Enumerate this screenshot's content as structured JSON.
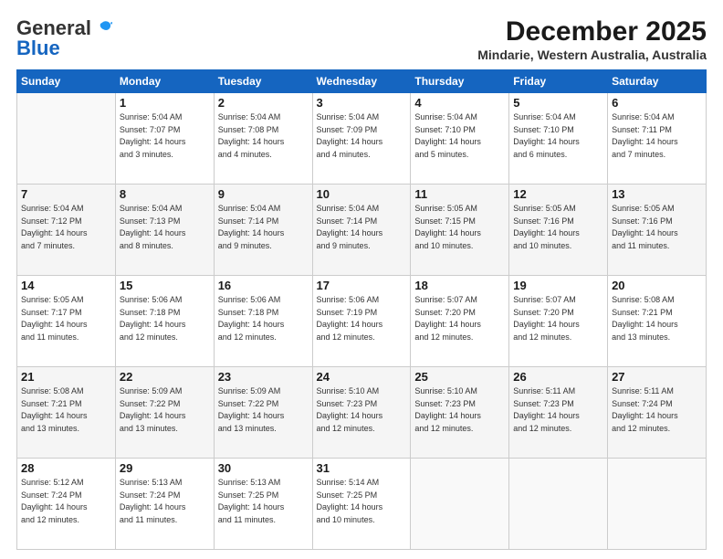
{
  "header": {
    "logo_general": "General",
    "logo_blue": "Blue",
    "month_title": "December 2025",
    "location": "Mindarie, Western Australia, Australia"
  },
  "weekdays": [
    "Sunday",
    "Monday",
    "Tuesday",
    "Wednesday",
    "Thursday",
    "Friday",
    "Saturday"
  ],
  "weeks": [
    [
      {
        "day": "",
        "detail": ""
      },
      {
        "day": "1",
        "detail": "Sunrise: 5:04 AM\nSunset: 7:07 PM\nDaylight: 14 hours\nand 3 minutes."
      },
      {
        "day": "2",
        "detail": "Sunrise: 5:04 AM\nSunset: 7:08 PM\nDaylight: 14 hours\nand 4 minutes."
      },
      {
        "day": "3",
        "detail": "Sunrise: 5:04 AM\nSunset: 7:09 PM\nDaylight: 14 hours\nand 4 minutes."
      },
      {
        "day": "4",
        "detail": "Sunrise: 5:04 AM\nSunset: 7:10 PM\nDaylight: 14 hours\nand 5 minutes."
      },
      {
        "day": "5",
        "detail": "Sunrise: 5:04 AM\nSunset: 7:10 PM\nDaylight: 14 hours\nand 6 minutes."
      },
      {
        "day": "6",
        "detail": "Sunrise: 5:04 AM\nSunset: 7:11 PM\nDaylight: 14 hours\nand 7 minutes."
      }
    ],
    [
      {
        "day": "7",
        "detail": "Sunrise: 5:04 AM\nSunset: 7:12 PM\nDaylight: 14 hours\nand 7 minutes."
      },
      {
        "day": "8",
        "detail": "Sunrise: 5:04 AM\nSunset: 7:13 PM\nDaylight: 14 hours\nand 8 minutes."
      },
      {
        "day": "9",
        "detail": "Sunrise: 5:04 AM\nSunset: 7:14 PM\nDaylight: 14 hours\nand 9 minutes."
      },
      {
        "day": "10",
        "detail": "Sunrise: 5:04 AM\nSunset: 7:14 PM\nDaylight: 14 hours\nand 9 minutes."
      },
      {
        "day": "11",
        "detail": "Sunrise: 5:05 AM\nSunset: 7:15 PM\nDaylight: 14 hours\nand 10 minutes."
      },
      {
        "day": "12",
        "detail": "Sunrise: 5:05 AM\nSunset: 7:16 PM\nDaylight: 14 hours\nand 10 minutes."
      },
      {
        "day": "13",
        "detail": "Sunrise: 5:05 AM\nSunset: 7:16 PM\nDaylight: 14 hours\nand 11 minutes."
      }
    ],
    [
      {
        "day": "14",
        "detail": "Sunrise: 5:05 AM\nSunset: 7:17 PM\nDaylight: 14 hours\nand 11 minutes."
      },
      {
        "day": "15",
        "detail": "Sunrise: 5:06 AM\nSunset: 7:18 PM\nDaylight: 14 hours\nand 12 minutes."
      },
      {
        "day": "16",
        "detail": "Sunrise: 5:06 AM\nSunset: 7:18 PM\nDaylight: 14 hours\nand 12 minutes."
      },
      {
        "day": "17",
        "detail": "Sunrise: 5:06 AM\nSunset: 7:19 PM\nDaylight: 14 hours\nand 12 minutes."
      },
      {
        "day": "18",
        "detail": "Sunrise: 5:07 AM\nSunset: 7:20 PM\nDaylight: 14 hours\nand 12 minutes."
      },
      {
        "day": "19",
        "detail": "Sunrise: 5:07 AM\nSunset: 7:20 PM\nDaylight: 14 hours\nand 12 minutes."
      },
      {
        "day": "20",
        "detail": "Sunrise: 5:08 AM\nSunset: 7:21 PM\nDaylight: 14 hours\nand 13 minutes."
      }
    ],
    [
      {
        "day": "21",
        "detail": "Sunrise: 5:08 AM\nSunset: 7:21 PM\nDaylight: 14 hours\nand 13 minutes."
      },
      {
        "day": "22",
        "detail": "Sunrise: 5:09 AM\nSunset: 7:22 PM\nDaylight: 14 hours\nand 13 minutes."
      },
      {
        "day": "23",
        "detail": "Sunrise: 5:09 AM\nSunset: 7:22 PM\nDaylight: 14 hours\nand 13 minutes."
      },
      {
        "day": "24",
        "detail": "Sunrise: 5:10 AM\nSunset: 7:23 PM\nDaylight: 14 hours\nand 12 minutes."
      },
      {
        "day": "25",
        "detail": "Sunrise: 5:10 AM\nSunset: 7:23 PM\nDaylight: 14 hours\nand 12 minutes."
      },
      {
        "day": "26",
        "detail": "Sunrise: 5:11 AM\nSunset: 7:23 PM\nDaylight: 14 hours\nand 12 minutes."
      },
      {
        "day": "27",
        "detail": "Sunrise: 5:11 AM\nSunset: 7:24 PM\nDaylight: 14 hours\nand 12 minutes."
      }
    ],
    [
      {
        "day": "28",
        "detail": "Sunrise: 5:12 AM\nSunset: 7:24 PM\nDaylight: 14 hours\nand 12 minutes."
      },
      {
        "day": "29",
        "detail": "Sunrise: 5:13 AM\nSunset: 7:24 PM\nDaylight: 14 hours\nand 11 minutes."
      },
      {
        "day": "30",
        "detail": "Sunrise: 5:13 AM\nSunset: 7:25 PM\nDaylight: 14 hours\nand 11 minutes."
      },
      {
        "day": "31",
        "detail": "Sunrise: 5:14 AM\nSunset: 7:25 PM\nDaylight: 14 hours\nand 10 minutes."
      },
      {
        "day": "",
        "detail": ""
      },
      {
        "day": "",
        "detail": ""
      },
      {
        "day": "",
        "detail": ""
      }
    ]
  ]
}
